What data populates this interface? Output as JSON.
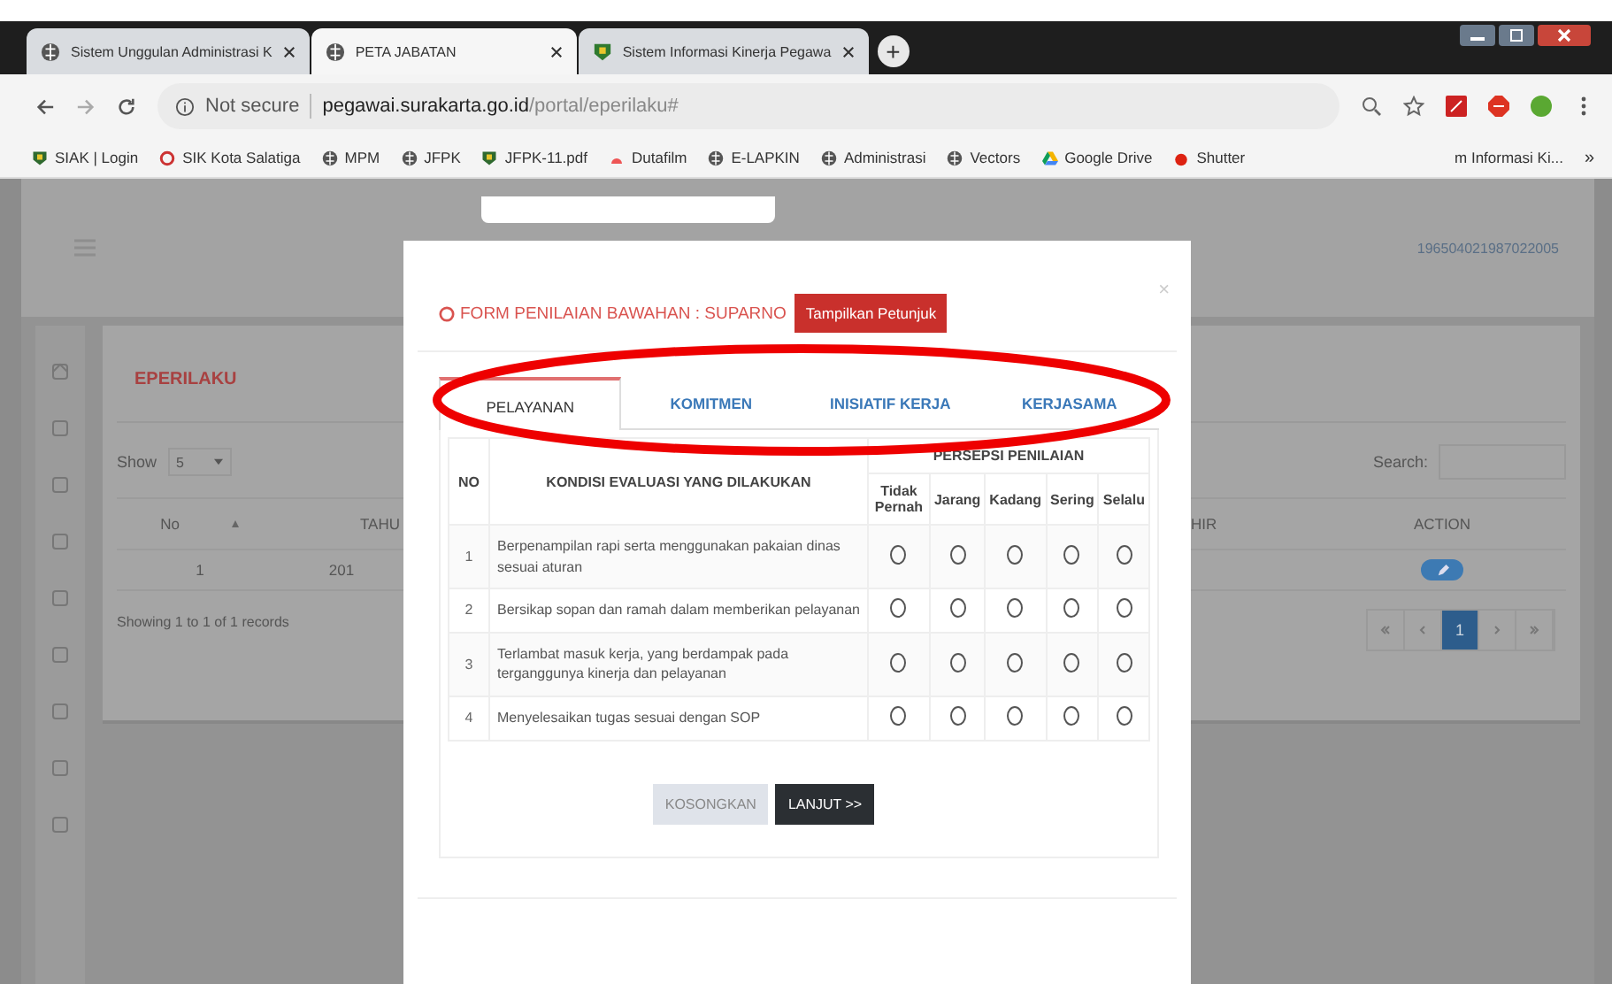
{
  "browser": {
    "tabs": [
      {
        "title": "Sistem Unggulan Administrasi K",
        "kind": "globe",
        "selected": false
      },
      {
        "title": "PETA JABATAN",
        "kind": "globe",
        "selected": true
      },
      {
        "title": "Sistem Informasi Kinerja Pegawa",
        "kind": "crest",
        "selected": false
      }
    ],
    "new_tab": "+",
    "address": {
      "security": "Not secure",
      "host": "pegawai.surakarta.go.id",
      "path": "/portal/eperilaku#"
    },
    "bookmarks": [
      {
        "label": "SIAK | Login",
        "kind": "crest"
      },
      {
        "label": "SIK Kota Salatiga",
        "kind": "ring"
      },
      {
        "label": "MPM",
        "kind": "globe"
      },
      {
        "label": "JFPK",
        "kind": "globe"
      },
      {
        "label": "JFPK-11.pdf",
        "kind": "crest"
      },
      {
        "label": "Dutafilm",
        "kind": "arc"
      },
      {
        "label": "E-LAPKIN",
        "kind": "globe"
      },
      {
        "label": "Administrasi",
        "kind": "globe"
      },
      {
        "label": "Vectors",
        "kind": "globe"
      },
      {
        "label": "Google Drive",
        "kind": "drive"
      },
      {
        "label": "Shutter",
        "kind": "dot"
      }
    ],
    "bookmark_overflow": "m Informasi Ki...",
    "more": "»"
  },
  "page": {
    "user_id": "196504021987022005",
    "card": {
      "title": "EPERILAKU",
      "show_label": "Show",
      "show_value": "5",
      "search_label": "Search:",
      "columns": [
        "No",
        "TAHU",
        "HIR",
        "ACTION"
      ],
      "rows": [
        {
          "no": "1",
          "year": "201"
        }
      ],
      "info": "Showing 1 to 1 of 1 records",
      "pages": [
        {
          "label": "1",
          "selected": true
        }
      ]
    }
  },
  "modal": {
    "title": "FORM PENILAIAN BAWAHAN : SUPARNO",
    "hint_button": "Tampilkan Petunjuk",
    "close": "×",
    "tabs": [
      {
        "label": "PELAYANAN",
        "selected": true
      },
      {
        "label": "KOMITMEN",
        "selected": false
      },
      {
        "label": "INISIATIF KERJA",
        "selected": false
      },
      {
        "label": "KERJASAMA",
        "selected": false
      }
    ],
    "table": {
      "no_header": "NO",
      "condition_header": "KONDISI EVALUASI YANG DILAKUKAN",
      "group_header": "PERSEPSI PENILAIAN",
      "scale": [
        "Tidak Pernah",
        "Jarang",
        "Kadang",
        "Sering",
        "Selalu"
      ],
      "items": [
        {
          "no": "1",
          "text": "Berpenampilan rapi serta menggunakan pakaian dinas sesuai aturan",
          "selected": [
            false,
            false,
            false,
            false,
            false
          ]
        },
        {
          "no": "2",
          "text": "Bersikap sopan dan ramah dalam memberikan pelayanan",
          "selected": [
            false,
            false,
            false,
            false,
            false
          ]
        },
        {
          "no": "3",
          "text": "Terlambat masuk kerja, yang berdampak pada terganggunya kinerja dan pelayanan",
          "selected": [
            false,
            false,
            false,
            false,
            false
          ]
        },
        {
          "no": "4",
          "text": "Menyelesaikan tugas sesuai dengan SOP",
          "selected": [
            false,
            false,
            false,
            false,
            false
          ]
        }
      ]
    },
    "buttons": [
      {
        "label": "KOSONGKAN",
        "kind": "secondary"
      },
      {
        "label": "LANJUT >>",
        "kind": "primary"
      }
    ]
  }
}
